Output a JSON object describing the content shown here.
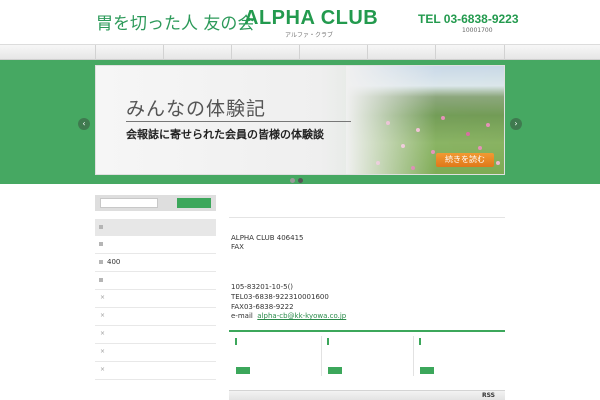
{
  "header": {
    "logo_jp": "胃を切った人 友の会",
    "logo_en": "ALPHA CLUB",
    "logo_sub": "アルファ・クラブ",
    "tel": "TEL 03-6838-9223",
    "tel_sub": "10001700"
  },
  "slider": {
    "title": "みんなの体験記",
    "subtitle": "会報誌に寄せられた会員の皆様の体験談",
    "button_label": "続きを読む",
    "prev_icon": "‹",
    "next_icon": "›",
    "dot_count": 2,
    "active_dot": 1
  },
  "sidebar": {
    "items": [
      {
        "label": ""
      },
      {
        "label": "400"
      },
      {
        "label": ""
      },
      {
        "label": ""
      },
      {
        "label": ""
      },
      {
        "label": ""
      },
      {
        "label": ""
      },
      {
        "label": ""
      }
    ],
    "cross_mark": "×"
  },
  "main": {
    "line1": "ALPHA CLUB 406415",
    "line2": "FAX",
    "addr1": "105-83201-10-5()",
    "addr2": "TEL03-6838-922310001600",
    "addr3": "FAX03-6838-9222",
    "email_label": "e-mail",
    "email": "alpha-cb@kk-kyowa.co.jp"
  },
  "footer": {
    "rss": "RSS"
  },
  "colors": {
    "brand_green": "#3ca75b",
    "accent_orange": "#e8881f"
  }
}
